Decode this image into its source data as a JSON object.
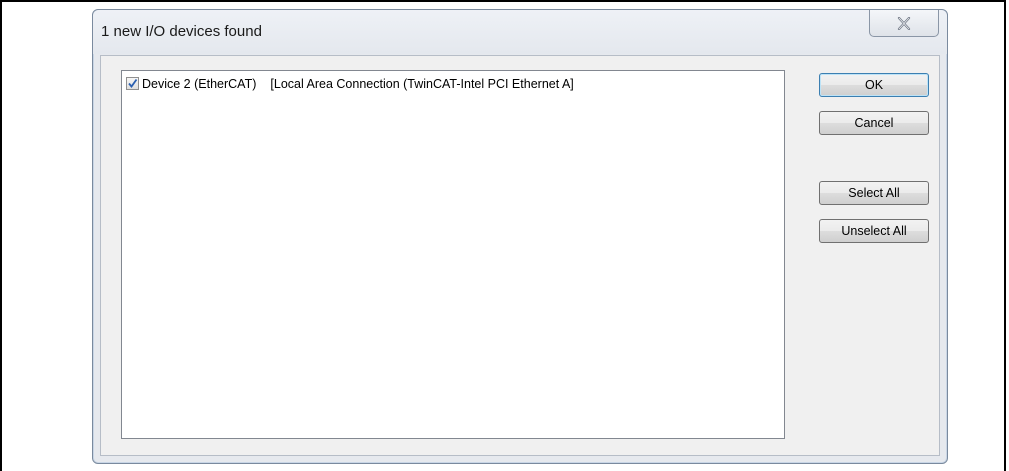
{
  "dialog": {
    "title": "1 new I/O devices found",
    "close_icon": "close-x-icon"
  },
  "devices": [
    {
      "checked": true,
      "name": "Device 2 (EtherCAT)",
      "detail": "[Local Area Connection (TwinCAT-Intel PCI Ethernet A]"
    }
  ],
  "buttons": {
    "ok": "OK",
    "cancel": "Cancel",
    "select_all": "Select All",
    "unselect_all": "Unselect All"
  },
  "colors": {
    "check_mark": "#2a5fb0",
    "window_border": "#7a8a9e"
  }
}
